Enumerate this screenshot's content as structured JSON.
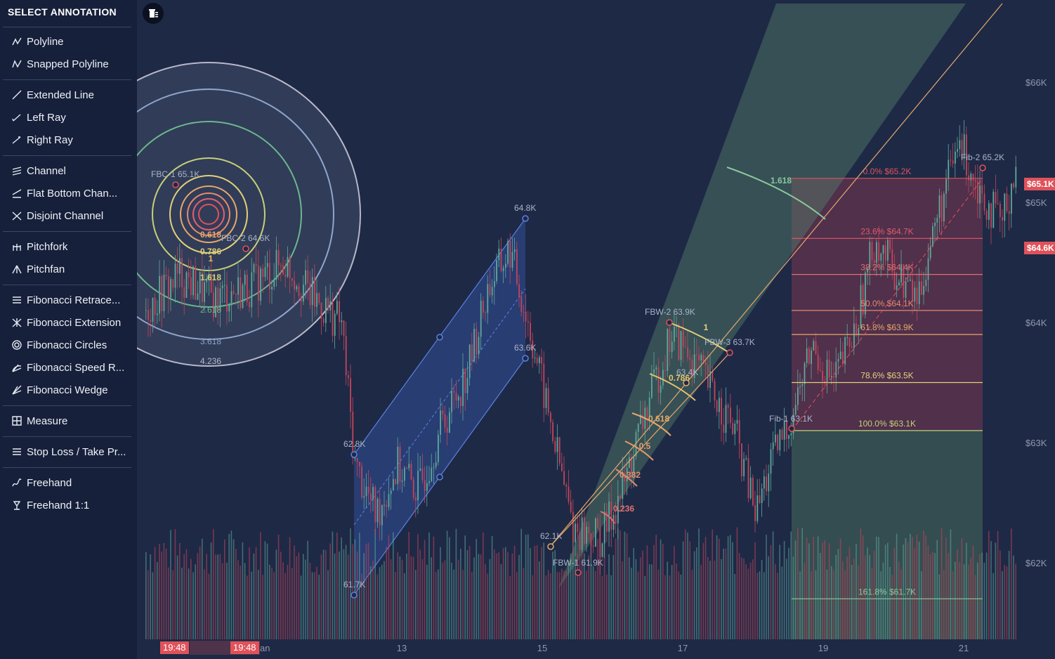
{
  "sidebar": {
    "title": "SELECT ANNOTATION",
    "groups": [
      [
        {
          "label": "Polyline",
          "icon": "polyline-icon"
        },
        {
          "label": "Snapped Polyline",
          "icon": "snapped-polyline-icon"
        }
      ],
      [
        {
          "label": "Extended Line",
          "icon": "extended-line-icon"
        },
        {
          "label": "Left Ray",
          "icon": "left-ray-icon"
        },
        {
          "label": "Right Ray",
          "icon": "right-ray-icon"
        }
      ],
      [
        {
          "label": "Channel",
          "icon": "channel-icon"
        },
        {
          "label": "Flat Bottom Chan...",
          "icon": "flat-bottom-channel-icon"
        },
        {
          "label": "Disjoint Channel",
          "icon": "disjoint-channel-icon"
        }
      ],
      [
        {
          "label": "Pitchfork",
          "icon": "pitchfork-icon"
        },
        {
          "label": "Pitchfan",
          "icon": "pitchfan-icon"
        }
      ],
      [
        {
          "label": "Fibonacci Retrace...",
          "icon": "fibonacci-retracement-icon"
        },
        {
          "label": "Fibonacci Extension",
          "icon": "fibonacci-extension-icon"
        },
        {
          "label": "Fibonacci Circles",
          "icon": "fibonacci-circles-icon"
        },
        {
          "label": "Fibonacci Speed R...",
          "icon": "fibonacci-speed-icon"
        },
        {
          "label": "Fibonacci Wedge",
          "icon": "fibonacci-wedge-icon"
        }
      ],
      [
        {
          "label": "Measure",
          "icon": "measure-icon"
        }
      ],
      [
        {
          "label": "Stop Loss / Take Pr...",
          "icon": "stop-loss-icon"
        }
      ],
      [
        {
          "label": "Freehand",
          "icon": "freehand-icon"
        },
        {
          "label": "Freehand 1:1",
          "icon": "freehand-1-1-icon"
        }
      ]
    ]
  },
  "chart": {
    "y_axis": [
      "$66K",
      "$65K",
      "$64K",
      "$63K",
      "$62K"
    ],
    "x_axis": [
      "13",
      "15",
      "17",
      "19",
      "21"
    ],
    "x_partial": "an",
    "price_tags": [
      "$65.1K",
      "$64.6K"
    ],
    "time_tags": [
      "19:48",
      "19:48"
    ],
    "fib_circles": {
      "levels": [
        "0.618",
        "0.786",
        "1",
        "1.618",
        "2.618",
        "3.618",
        "4.236"
      ],
      "points": [
        "FBC-1 65.1K",
        "FBC-2 64.6K"
      ]
    },
    "channel": {
      "labels": [
        "64.8K",
        "63.6K",
        "62.8K",
        "61.7K"
      ]
    },
    "fib_wedge": {
      "levels": [
        "0.236",
        "0.382",
        "0.5",
        "0.618",
        "0.786",
        "1",
        "1.618"
      ],
      "points": [
        "FBW-1 61.9K",
        "FBW-2 63.9K",
        "FBW-3 63.7K"
      ],
      "labels": [
        "62.1K",
        "63.4K"
      ]
    },
    "fib_retracement": {
      "levels": [
        "0.0% $65.2K",
        "23.6% $64.7K",
        "38.2% $64.4K",
        "50.0% $64.1K",
        "61.8% $63.9K",
        "78.6% $63.5K",
        "100.0% $63.1K",
        "161.8% $61.7K"
      ],
      "points": [
        "Fib-1 63.1K",
        "Fib-2 65.2K"
      ]
    },
    "colors": {
      "up": "#5fa89a",
      "down": "#c2455a",
      "bg": "#1e2946",
      "accent": "#e0525a"
    }
  }
}
